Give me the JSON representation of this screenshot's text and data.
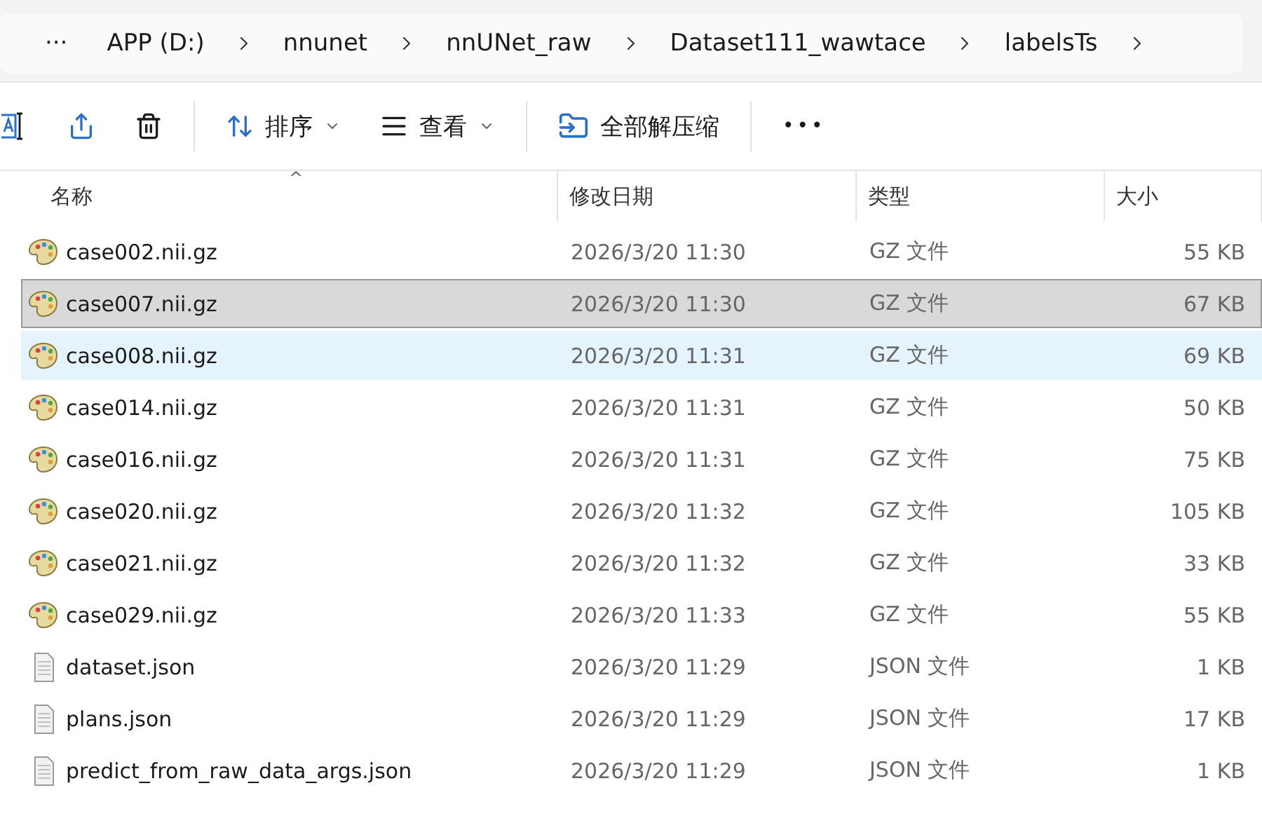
{
  "breadcrumb": {
    "more": "···",
    "items": [
      "APP (D:)",
      "nnunet",
      "nnUNet_raw",
      "Dataset111_wawtace",
      "labelsTs"
    ]
  },
  "toolbar": {
    "items": [
      {
        "kind": "rename"
      },
      {
        "kind": "share"
      },
      {
        "kind": "delete"
      },
      {
        "kind": "sort",
        "label": "排序"
      },
      {
        "kind": "view",
        "label": "查看"
      },
      {
        "kind": "extract",
        "label": "全部解压缩"
      }
    ],
    "more": "•••"
  },
  "table": {
    "columns": [
      "名称",
      "修改日期",
      "类型",
      "大小"
    ],
    "sort_arrow": "^",
    "rows": [
      {
        "kind": "nifti",
        "name": "case002.nii.gz",
        "date": "2026/3/20 11:30",
        "type": "GZ 文件",
        "size": "55 KB",
        "selected": false,
        "hovered": false
      },
      {
        "kind": "nifti",
        "name": "case007.nii.gz",
        "date": "2026/3/20 11:30",
        "type": "GZ 文件",
        "size": "67 KB",
        "selected": true,
        "hovered": false
      },
      {
        "kind": "nifti",
        "name": "case008.nii.gz",
        "date": "2026/3/20 11:31",
        "type": "GZ 文件",
        "size": "69 KB",
        "selected": false,
        "hovered": true
      },
      {
        "kind": "nifti",
        "name": "case014.nii.gz",
        "date": "2026/3/20 11:31",
        "type": "GZ 文件",
        "size": "50 KB",
        "selected": false,
        "hovered": false
      },
      {
        "kind": "nifti",
        "name": "case016.nii.gz",
        "date": "2026/3/20 11:31",
        "type": "GZ 文件",
        "size": "75 KB",
        "selected": false,
        "hovered": false
      },
      {
        "kind": "nifti",
        "name": "case020.nii.gz",
        "date": "2026/3/20 11:32",
        "type": "GZ 文件",
        "size": "105 KB",
        "selected": false,
        "hovered": false
      },
      {
        "kind": "nifti",
        "name": "case021.nii.gz",
        "date": "2026/3/20 11:32",
        "type": "GZ 文件",
        "size": "33 KB",
        "selected": false,
        "hovered": false
      },
      {
        "kind": "nifti",
        "name": "case029.nii.gz",
        "date": "2026/3/20 11:33",
        "type": "GZ 文件",
        "size": "55 KB",
        "selected": false,
        "hovered": false
      },
      {
        "kind": "json",
        "name": "dataset.json",
        "date": "2026/3/20 11:29",
        "type": "JSON 文件",
        "size": "1 KB",
        "selected": false,
        "hovered": false
      },
      {
        "kind": "json",
        "name": "plans.json",
        "date": "2026/3/20 11:29",
        "type": "JSON 文件",
        "size": "17 KB",
        "selected": false,
        "hovered": false
      },
      {
        "kind": "json",
        "name": "predict_from_raw_data_args.json",
        "date": "2026/3/20 11:29",
        "type": "JSON 文件",
        "size": "1 KB",
        "selected": false,
        "hovered": false
      }
    ]
  }
}
